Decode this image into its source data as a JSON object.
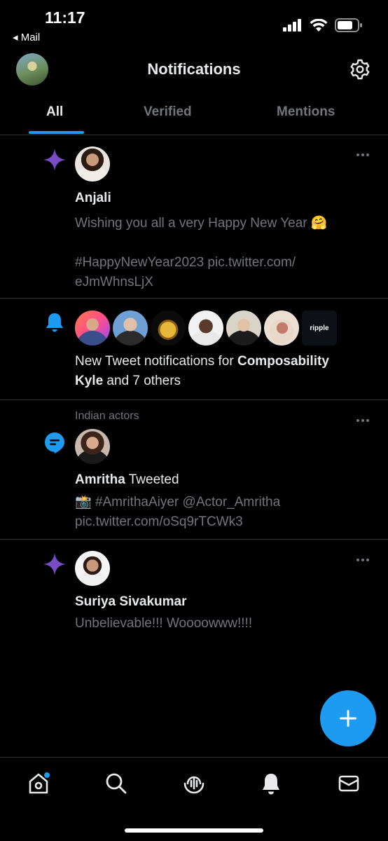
{
  "status_bar": {
    "time": "11:17",
    "back_app": "◂ Mail"
  },
  "header": {
    "title": "Notifications"
  },
  "tabs": [
    {
      "label": "All",
      "active": true
    },
    {
      "label": "Verified",
      "active": false
    },
    {
      "label": "Mentions",
      "active": false
    }
  ],
  "notifications": [
    {
      "type": "sparkle",
      "name": "Anjali",
      "text_line1": "Wishing you all a very Happy New Year 🤗",
      "text_line2": "#HappyNewYear2023 pic.twitter.com/",
      "text_line3": "eJmWhnsLjX"
    },
    {
      "type": "bell",
      "text_prefix": "New Tweet notifications for ",
      "bold_name_1": "Composability",
      "bold_name_2": "Kyle",
      "text_suffix": " and 7 others",
      "avatar_badge": "ripple"
    },
    {
      "type": "topic",
      "context": "Indian actors",
      "name": "Amritha",
      "action": " Tweeted",
      "text_line1": "📸 #AmrithaAiyer @Actor_Amritha",
      "text_line2": "pic.twitter.com/oSq9rTCWk3"
    },
    {
      "type": "sparkle",
      "name": "Suriya Sivakumar",
      "text_line1": "Unbelievable!!! Woooowww!!!!"
    }
  ],
  "fab": {
    "icon": "plus-icon"
  },
  "bottom_nav": [
    {
      "icon": "home-icon",
      "has_badge": true
    },
    {
      "icon": "search-icon"
    },
    {
      "icon": "spaces-icon"
    },
    {
      "icon": "bell-icon",
      "active": true
    },
    {
      "icon": "mail-icon"
    }
  ],
  "colors": {
    "accent": "#1d9bf0",
    "sparkle": "#794bc4",
    "muted": "#71767b",
    "text": "#e7e9ea"
  }
}
